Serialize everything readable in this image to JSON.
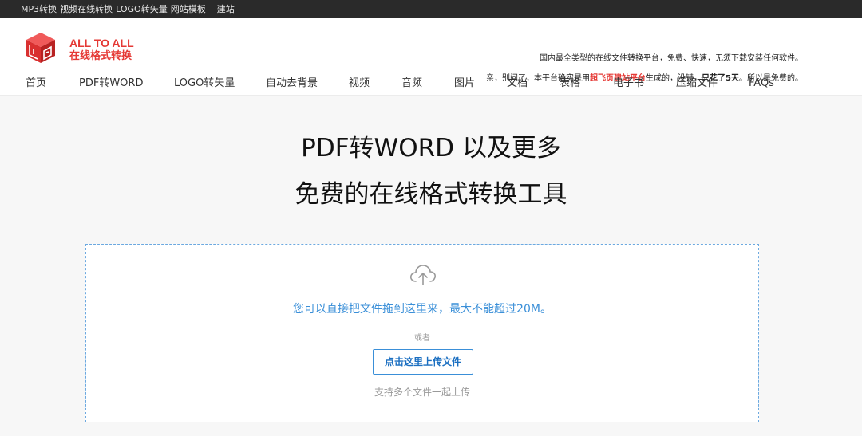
{
  "topbar": {
    "links": [
      "MP3转换",
      "视频在线转换",
      "LOGO转矢量",
      "网站模板",
      "建站"
    ]
  },
  "brand": {
    "name_en": "ALL TO ALL",
    "name_cn": "在线格式转换"
  },
  "header": {
    "slogan": "国内最全类型的在线文件转换平台，免费、快速，无须下载安装任何软件。",
    "note_part1": "亲，别问了，本平台确实是用",
    "note_highlight": "超飞页建站平台",
    "note_part2": "生成的，没错，",
    "note_bold": "只花了5天",
    "note_part3": "。所以是免费的。"
  },
  "nav": {
    "items": [
      "首页",
      "PDF转WORD",
      "LOGO转矢量",
      "自动去背景",
      "视频",
      "音频",
      "图片",
      "文档",
      "表格",
      "电子书",
      "压缩文件",
      "FAQs"
    ]
  },
  "hero": {
    "line1": "PDF转WORD 以及更多",
    "line2": "免费的在线格式转换工具"
  },
  "dropzone": {
    "main_text": "您可以直接把文件拖到这里来，最大不能超过20M。",
    "or_text": "或者",
    "button_label": "点击这里上传文件",
    "multi_text": "支持多个文件一起上传"
  },
  "colors": {
    "brand_red": "#e53935",
    "accent_blue": "#3a8fd8",
    "topbar_bg": "#2a2a2a"
  },
  "icons": {
    "logo": "cube-logo-icon",
    "upload": "cloud-upload-icon"
  }
}
